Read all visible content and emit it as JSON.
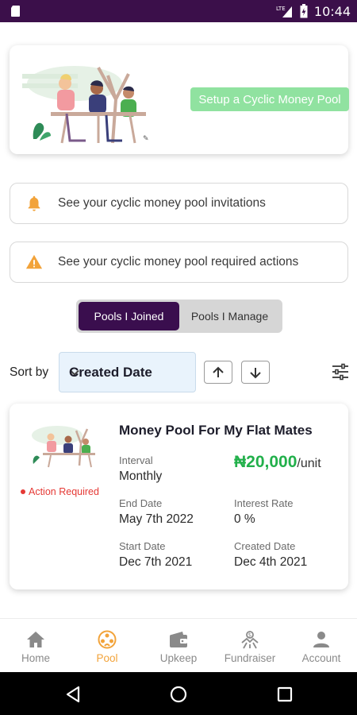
{
  "status_bar": {
    "time": "10:44",
    "network_label": "LTE"
  },
  "hero": {
    "setup_button_label": "Setup a Cyclic Money Pool"
  },
  "info_rows": [
    {
      "text": "See your cyclic money pool invitations",
      "icon": "bell-icon",
      "icon_color": "#f2a33a"
    },
    {
      "text": "See your cyclic money pool required actions",
      "icon": "warning-icon",
      "icon_color": "#f2a33a"
    }
  ],
  "tabs": {
    "joined_label": "Pools I Joined",
    "manage_label": "Pools I Manage",
    "active": "joined"
  },
  "sort": {
    "label": "Sort by",
    "selected": "Created Date"
  },
  "pool": {
    "title": "Money Pool For My Flat Mates",
    "status": "Action Required",
    "interval_label": "Interval",
    "interval_value": "Monthly",
    "amount": "₦20,000",
    "amount_unit": "/unit",
    "end_date_label": "End Date",
    "end_date_value": "May 7th 2022",
    "interest_rate_label": "Interest Rate",
    "interest_rate_value": "0 %",
    "start_date_label": "Start Date",
    "start_date_value": "Dec 7th 2021",
    "created_date_label": "Created Date",
    "created_date_value": "Dec 4th 2021"
  },
  "bottom_nav": {
    "items": [
      {
        "label": "Home",
        "icon": "home-icon"
      },
      {
        "label": "Pool",
        "icon": "pool-icon"
      },
      {
        "label": "Upkeep",
        "icon": "wallet-icon"
      },
      {
        "label": "Fundraiser",
        "icon": "fundraiser-icon"
      },
      {
        "label": "Account",
        "icon": "account-icon"
      }
    ],
    "active": "Pool"
  },
  "colors": {
    "brand_purple": "#3a0e4e",
    "accent_green": "#22b04b",
    "button_green": "#90e2a0",
    "accent_orange": "#f2a33a",
    "alert_red": "#e53935"
  }
}
